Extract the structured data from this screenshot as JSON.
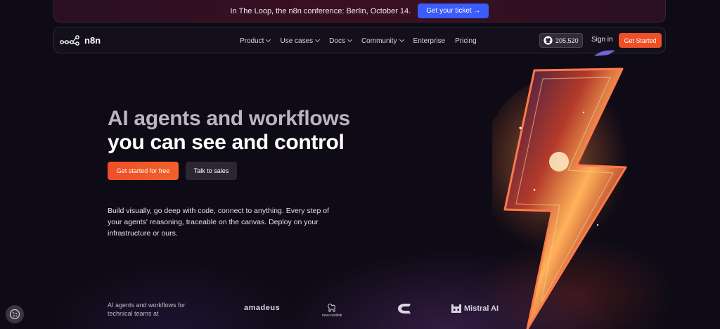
{
  "announcement": {
    "text": "In The Loop, the n8n conference: Berlin, October 14.",
    "button_label": "Get your ticket →"
  },
  "nav": {
    "logo_text": "n8n",
    "links": [
      {
        "label": "Product",
        "has_dropdown": true
      },
      {
        "label": "Use cases",
        "has_dropdown": true
      },
      {
        "label": "Docs",
        "has_dropdown": true
      },
      {
        "label": "Community",
        "has_dropdown": true
      },
      {
        "label": "Enterprise",
        "has_dropdown": false
      },
      {
        "label": "Pricing",
        "has_dropdown": false
      }
    ],
    "github_stars": "205,520",
    "signin_label": "Sign in",
    "get_started_label": "Get Started"
  },
  "hero": {
    "title_line1": "AI agents and workflows",
    "title_line2": "you can see and control",
    "cta_primary": "Get started for free",
    "cta_secondary": "Talk to sales",
    "description": "Build visually, go deep with code, connect to anything. Every step of your agents' reasoning, traceable on the canvas. Deploy on your infrastructure or ours."
  },
  "logos_strip": {
    "text": "AI agents and workflows for technical teams at",
    "brands": [
      "amadeus",
      "novo nordisk",
      "Mistral AI"
    ]
  },
  "colors": {
    "accent_orange": "#ee4f27",
    "ticket_blue": "#3b5bfb",
    "background": "#0e0b16"
  }
}
